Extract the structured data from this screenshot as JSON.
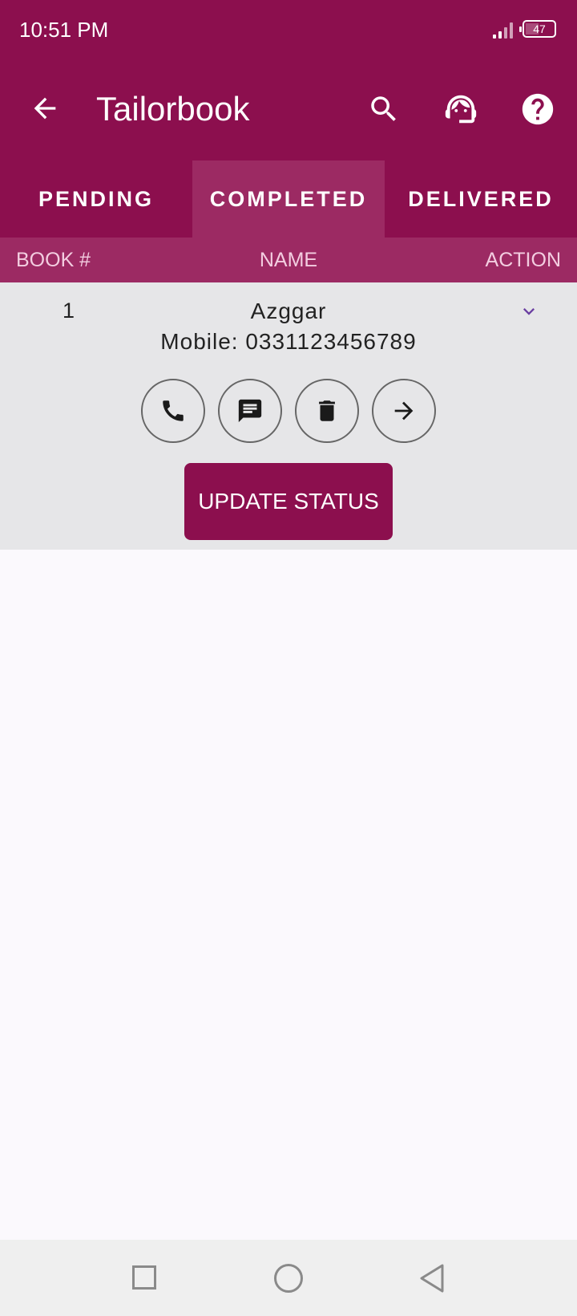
{
  "status_bar": {
    "time": "10:51 PM",
    "battery": "47"
  },
  "app_bar": {
    "title": "Tailorbook"
  },
  "tabs": [
    {
      "label": "PENDING",
      "active": false
    },
    {
      "label": "COMPLETED",
      "active": true
    },
    {
      "label": "DELIVERED",
      "active": false
    }
  ],
  "table_header": {
    "book": "BOOK #",
    "name": "NAME",
    "action": "ACTION"
  },
  "orders": [
    {
      "book_number": "1",
      "name": "Azggar",
      "mobile": "Mobile: 0331123456789",
      "update_label": "UPDATE STATUS"
    }
  ],
  "colors": {
    "primary": "#8c0f4e",
    "tab_active": "#9c2a63",
    "row_bg": "#e6e6e8",
    "accent": "#6a3ea1"
  },
  "icons": [
    "back-arrow-icon",
    "search-icon",
    "support-agent-icon",
    "help-icon",
    "chevron-down-icon",
    "phone-icon",
    "message-icon",
    "trash-icon",
    "arrow-right-icon"
  ]
}
